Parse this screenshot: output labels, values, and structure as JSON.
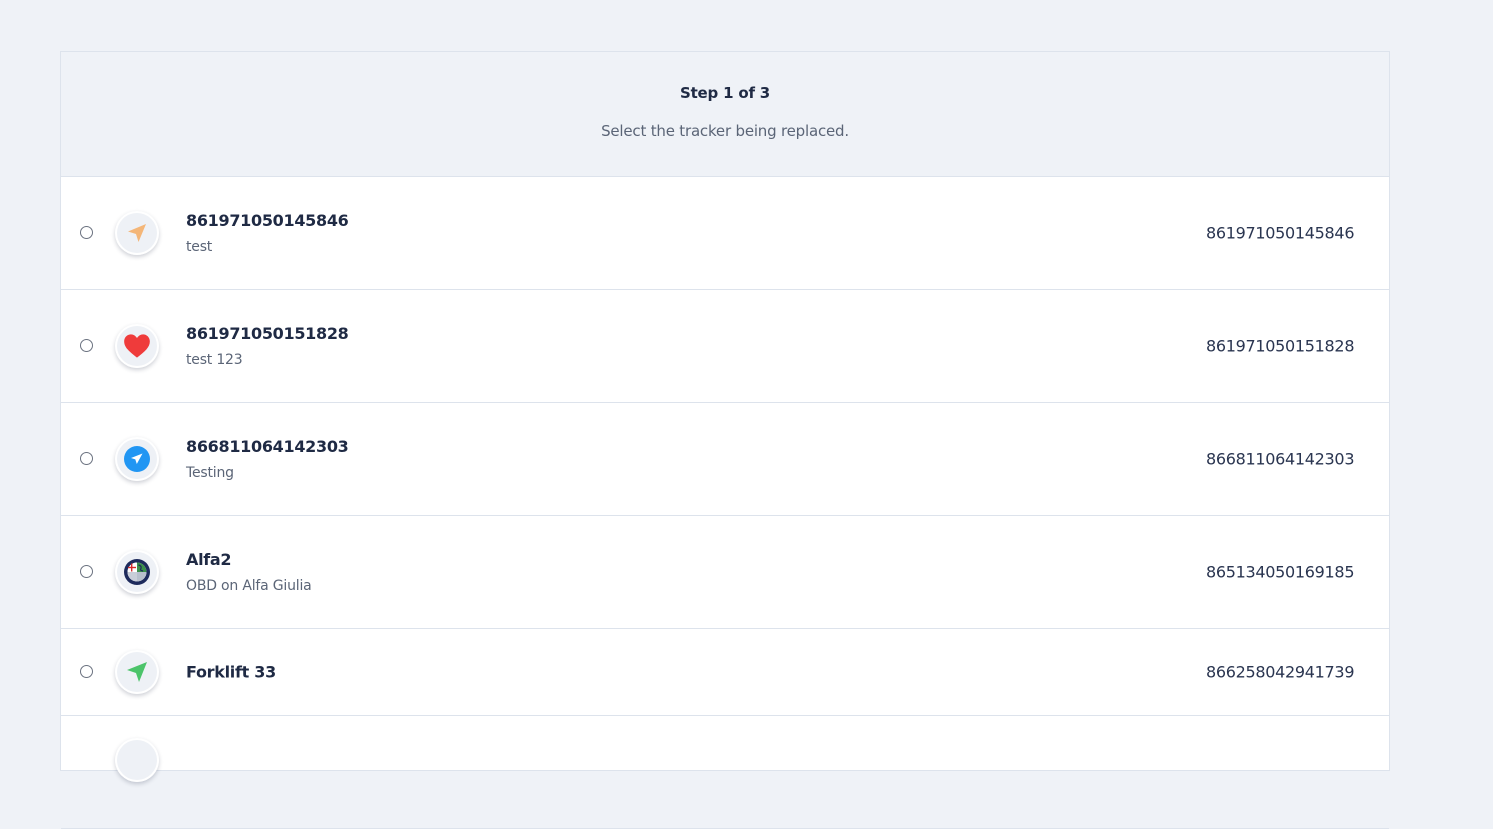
{
  "header": {
    "step": "Step 1 of 3",
    "instruction": "Select the tracker being replaced."
  },
  "trackers": [
    {
      "name": "861971050145846",
      "description": "test",
      "imei": "861971050145846",
      "icon": "navigation-arrow-icon",
      "icon_color": "#f4b678"
    },
    {
      "name": "861971050151828",
      "description": "test 123",
      "imei": "861971050151828",
      "icon": "heart-icon",
      "icon_color": "#ef3b3b"
    },
    {
      "name": "866811064142303",
      "description": "Testing",
      "imei": "866811064142303",
      "icon": "telegram-icon",
      "icon_color": "#2196f3"
    },
    {
      "name": "Alfa2",
      "description": "OBD on Alfa Giulia",
      "imei": "865134050169185",
      "icon": "alfa-romeo-logo-icon",
      "icon_color": "#1d2a5c"
    },
    {
      "name": "Forklift 33",
      "description": "",
      "imei": "866258042941739",
      "icon": "navigation-arrow-icon",
      "icon_color": "#4cc46a"
    }
  ]
}
